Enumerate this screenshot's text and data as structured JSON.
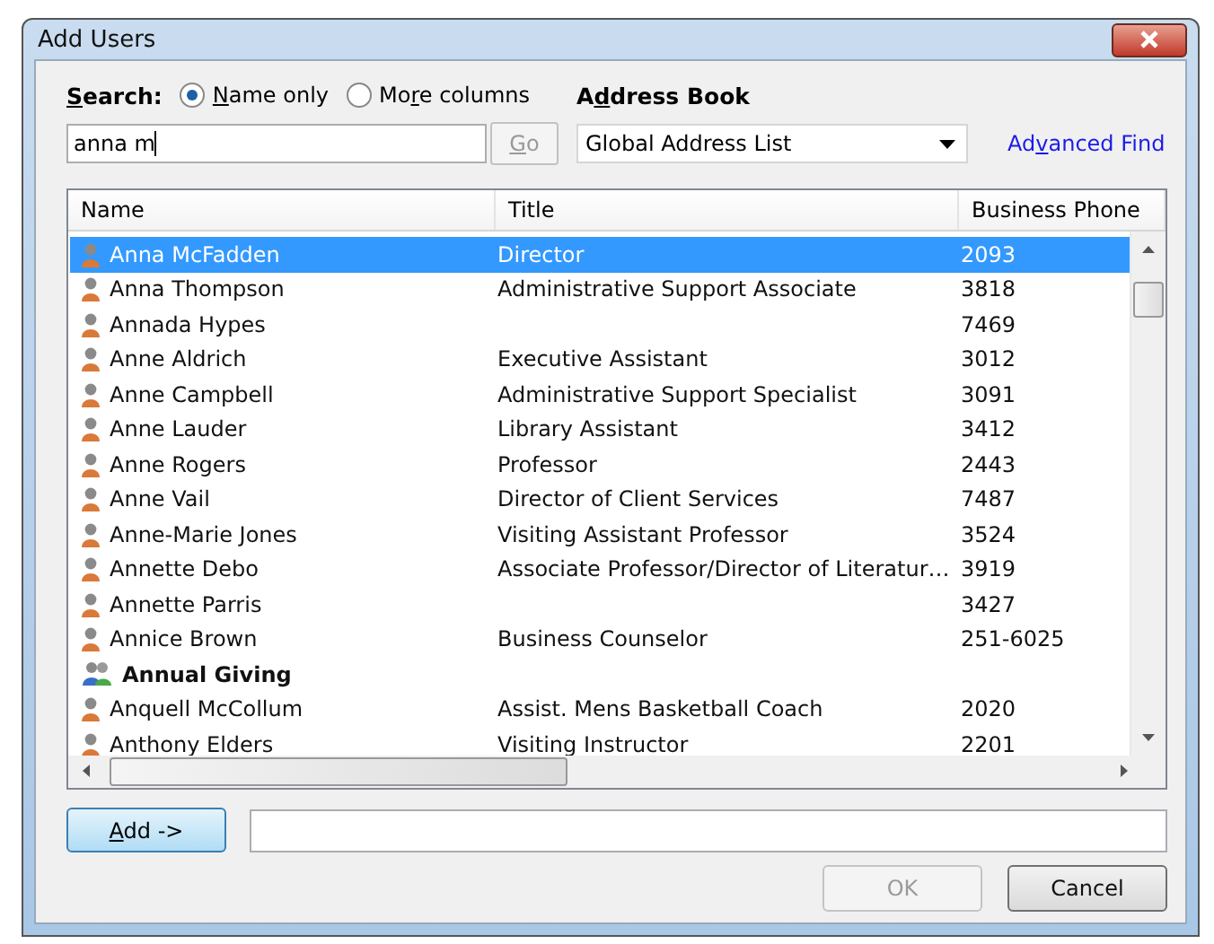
{
  "window": {
    "title": "Add Users"
  },
  "search": {
    "label_parts": {
      "key": "S",
      "after": "earch:"
    },
    "value": "anna m",
    "go_parts": {
      "key": "G",
      "after": "o"
    },
    "options": [
      {
        "label_parts": {
          "key": "N",
          "after": "ame only"
        },
        "selected": true
      },
      {
        "label_parts": {
          "before": "Mo",
          "key": "r",
          "after": "e columns"
        },
        "selected": false
      }
    ]
  },
  "address_book": {
    "label_parts": {
      "before": "A",
      "key": "d",
      "after": "dress Book"
    },
    "value": "Global Address List",
    "advanced_parts": {
      "before": "Ad",
      "key": "v",
      "after": "anced Find"
    }
  },
  "table": {
    "columns": [
      "Name",
      "Title",
      "Business Phone"
    ],
    "rows": [
      {
        "kind": "person",
        "name": "Anna McFadden",
        "title": "Director",
        "phone": "2093",
        "selected": true
      },
      {
        "kind": "person",
        "name": "Anna Thompson",
        "title": "Administrative Support Associate",
        "phone": "3818",
        "selected": false
      },
      {
        "kind": "person",
        "name": "Annada Hypes",
        "phone": "7469",
        "selected": false
      },
      {
        "kind": "person",
        "name": "Anne Aldrich",
        "title": "Executive Assistant",
        "phone": "3012",
        "selected": false
      },
      {
        "kind": "person",
        "name": "Anne Campbell",
        "title": "Administrative Support Specialist",
        "phone": "3091",
        "selected": false
      },
      {
        "kind": "person",
        "name": "Anne Lauder",
        "title": "Library Assistant",
        "phone": "3412",
        "selected": false
      },
      {
        "kind": "person",
        "name": "Anne Rogers",
        "title": "Professor",
        "phone": "2443",
        "selected": false
      },
      {
        "kind": "person",
        "name": "Anne Vail",
        "title": "Director of Client Services",
        "phone": "7487",
        "selected": false
      },
      {
        "kind": "person",
        "name": "Anne-Marie Jones",
        "title": "Visiting Assistant Professor",
        "phone": "3524",
        "selected": false
      },
      {
        "kind": "person",
        "name": "Annette Debo",
        "title": "Associate Professor/Director of Literatur…",
        "phone": "3919",
        "selected": false
      },
      {
        "kind": "person",
        "name": "Annette Parris",
        "phone": "3427",
        "selected": false
      },
      {
        "kind": "person",
        "name": "Annice Brown",
        "title": "Business Counselor",
        "phone": "251-6025",
        "selected": false
      },
      {
        "kind": "group",
        "name": "Annual Giving",
        "selected": false
      },
      {
        "kind": "person",
        "name": "Anquell McCollum",
        "title": "Assist. Mens Basketball Coach",
        "phone": "2020",
        "selected": false
      },
      {
        "kind": "person",
        "name": "Anthony Elders",
        "title": "Visiting Instructor",
        "phone": "2201",
        "selected": false
      }
    ]
  },
  "add_button": {
    "label_parts": {
      "key": "A",
      "after": "dd ->"
    }
  },
  "buttons": [
    {
      "label": "OK",
      "disabled": true
    },
    {
      "label": "Cancel",
      "disabled": false
    }
  ]
}
